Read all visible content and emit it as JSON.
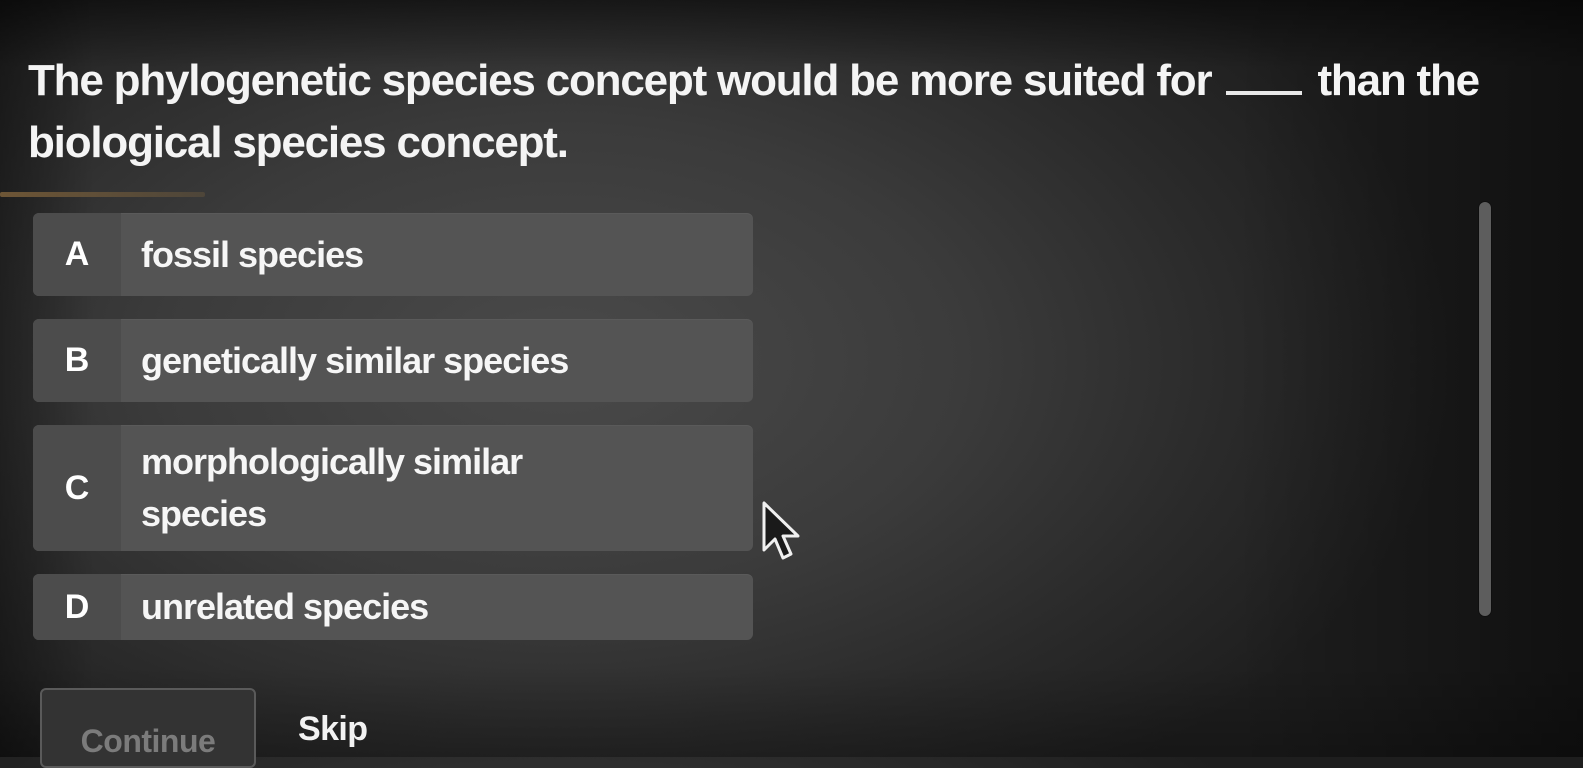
{
  "question": {
    "before_blank": "The phylogenetic species concept would be more suited for",
    "blank": "____",
    "after_blank": "than the biological species concept."
  },
  "options": [
    {
      "letter": "A",
      "text": "fossil species"
    },
    {
      "letter": "B",
      "text": "genetically similar species"
    },
    {
      "letter": "C",
      "text": "morphologically similar species"
    },
    {
      "letter": "D",
      "text": "unrelated species"
    }
  ],
  "actions": {
    "continue_label": "Continue",
    "skip_label": "Skip"
  },
  "colors": {
    "background": "#3b3b3b",
    "option_background": "#545454",
    "option_letter_background": "#4c4c4c",
    "text": "#f4f4f4",
    "continue_disabled_text": "#7b7b7b"
  },
  "icons": {
    "cursor": "mouse-pointer-icon"
  }
}
